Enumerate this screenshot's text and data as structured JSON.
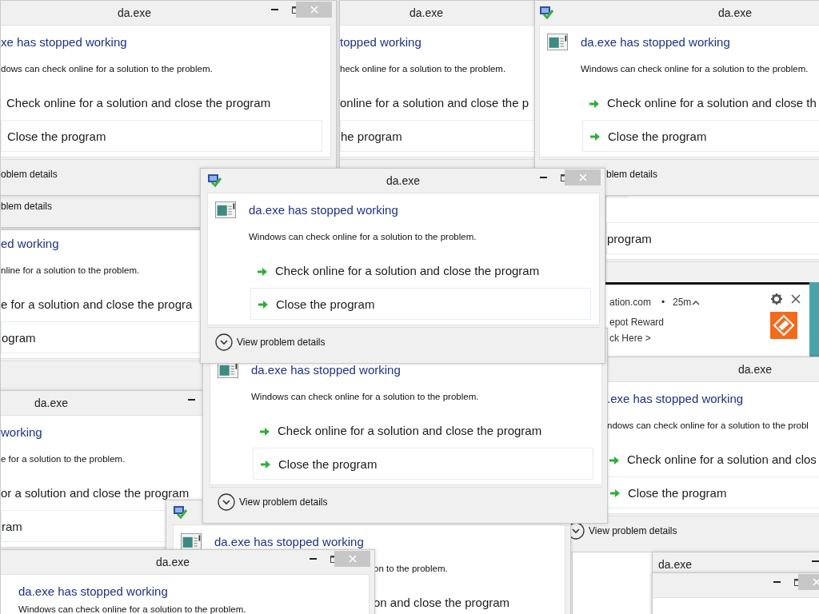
{
  "windows": [
    {
      "title": "da.exe",
      "heading": "xe has stopped working",
      "description": "dows can check online for a solution to the problem.",
      "check_action": "Check online for a solution and close the program",
      "close_action": "Close the program",
      "details": "oblem details"
    },
    {
      "title": "da.exe",
      "heading": "topped working",
      "description": "heck online for a solution to the problem.",
      "check_action": "online for a solution and close the p",
      "close_action": "he program"
    },
    {
      "title": "da.exe",
      "heading": "da.exe has stopped working",
      "description": "Windows can check online for a solution to the problem.",
      "check_action": "Check online for a solution and close th",
      "close_action": "Close the program",
      "details": "blem details"
    },
    {
      "details": "blem details"
    },
    {
      "heading": "ed working",
      "description": "nline for a solution to the problem.",
      "check_action": "e for a solution and close the progra",
      "close_action": "ogram"
    },
    {
      "title": "da.exe",
      "heading": "da.exe has stopped working",
      "description": "Windows can check online for a solution to the problem.",
      "check_action": "Check online for a solution and close the program",
      "close_action": "Close the program",
      "details": "View problem details"
    },
    {
      "close_action": "program"
    },
    {
      "title": "da.exe",
      "heading": "working",
      "description": "e for a solution to the problem.",
      "check_action": "or a solution and close the program",
      "close_action": "ram"
    },
    {
      "heading": "da.exe has stopped working",
      "description": "Windows can check online for a solution to the problem.",
      "check_action": "Check online for a solution and close the program",
      "close_action": "Close the program",
      "details": "View problem details"
    },
    {
      "title": "da.exe",
      "heading": ".exe has stopped working",
      "description": "ndows can check online for a solution to the probl",
      "check_action": "Check online for a solution and clos",
      "close_action": "Close the program",
      "details": "View problem details"
    },
    {
      "title": "da.exe",
      "heading": "da.exe has stopped working",
      "description": "Windows can check online for a solution to the problem."
    },
    {
      "heading": "da.exe has stopped working",
      "description": "on to the problem.",
      "check_action": "on and close the program"
    },
    {
      "title": "da.exe"
    }
  ],
  "notification": {
    "source": "ation.com",
    "separator": "•",
    "time": "25m",
    "title": "epot Reward",
    "link": "ck Here >"
  }
}
